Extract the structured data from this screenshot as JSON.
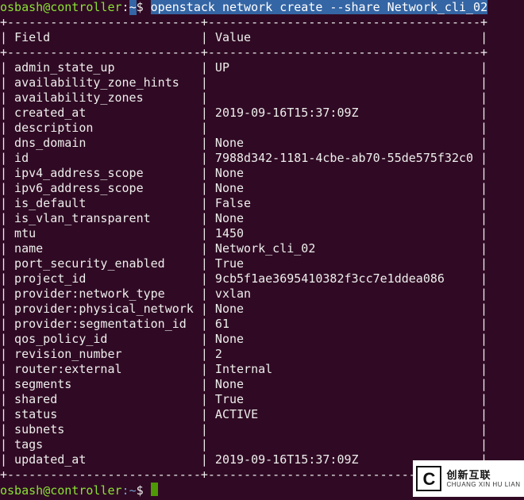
{
  "prompt1": {
    "user": "osbash",
    "host": "controller",
    "path": "~",
    "tilde_pre": ":",
    "command": "openstack network create --share Network_cli_02"
  },
  "prompt2": {
    "user": "osbash",
    "host": "controller",
    "path": "~"
  },
  "table": {
    "border_top": "+---------------------------+--------------------------------------+",
    "border_mid": "+---------------------------+--------------------------------------+",
    "border_bottom": "+---------------------------+--------------------------------------+",
    "header_field": "Field",
    "header_value": "Value",
    "rows": [
      {
        "field": "admin_state_up",
        "value": "UP"
      },
      {
        "field": "availability_zone_hints",
        "value": ""
      },
      {
        "field": "availability_zones",
        "value": ""
      },
      {
        "field": "created_at",
        "value": "2019-09-16T15:37:09Z"
      },
      {
        "field": "description",
        "value": ""
      },
      {
        "field": "dns_domain",
        "value": "None"
      },
      {
        "field": "id",
        "value": "7988d342-1181-4cbe-ab70-55de575f32c0"
      },
      {
        "field": "ipv4_address_scope",
        "value": "None"
      },
      {
        "field": "ipv6_address_scope",
        "value": "None"
      },
      {
        "field": "is_default",
        "value": "False"
      },
      {
        "field": "is_vlan_transparent",
        "value": "None"
      },
      {
        "field": "mtu",
        "value": "1450"
      },
      {
        "field": "name",
        "value": "Network_cli_02"
      },
      {
        "field": "port_security_enabled",
        "value": "True"
      },
      {
        "field": "project_id",
        "value": "9cb5f1ae3695410382f3cc7e1ddea086"
      },
      {
        "field": "provider:network_type",
        "value": "vxlan"
      },
      {
        "field": "provider:physical_network",
        "value": "None"
      },
      {
        "field": "provider:segmentation_id",
        "value": "61"
      },
      {
        "field": "qos_policy_id",
        "value": "None"
      },
      {
        "field": "revision_number",
        "value": "2"
      },
      {
        "field": "router:external",
        "value": "Internal"
      },
      {
        "field": "segments",
        "value": "None"
      },
      {
        "field": "shared",
        "value": "True"
      },
      {
        "field": "status",
        "value": "ACTIVE"
      },
      {
        "field": "subnets",
        "value": ""
      },
      {
        "field": "tags",
        "value": ""
      },
      {
        "field": "updated_at",
        "value": "2019-09-16T15:37:09Z"
      }
    ]
  },
  "watermark": {
    "cn": "创新互联",
    "py": "CHUANG XIN HU LIAN"
  }
}
